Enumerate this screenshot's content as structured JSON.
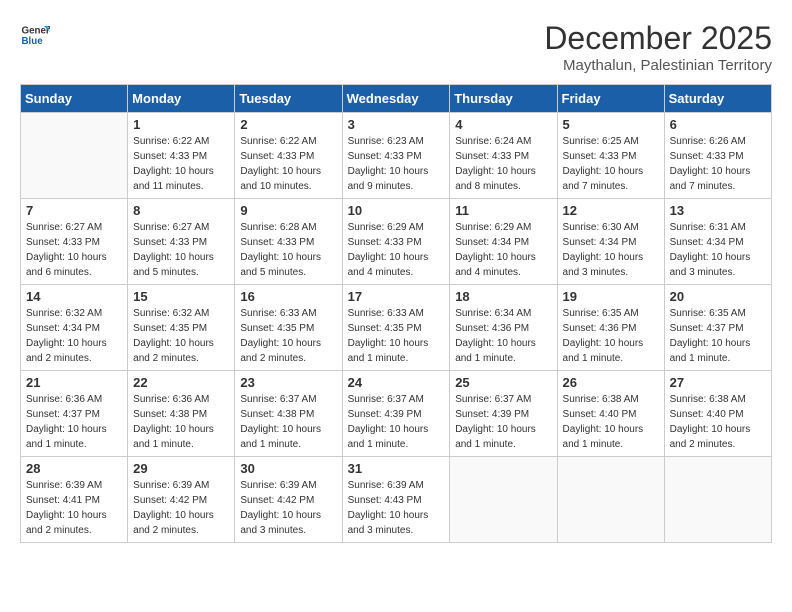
{
  "header": {
    "logo_line1": "General",
    "logo_line2": "Blue",
    "month_year": "December 2025",
    "location": "Maythalun, Palestinian Territory"
  },
  "weekdays": [
    "Sunday",
    "Monday",
    "Tuesday",
    "Wednesday",
    "Thursday",
    "Friday",
    "Saturday"
  ],
  "weeks": [
    [
      {
        "day": "",
        "info": ""
      },
      {
        "day": "1",
        "info": "Sunrise: 6:22 AM\nSunset: 4:33 PM\nDaylight: 10 hours\nand 11 minutes."
      },
      {
        "day": "2",
        "info": "Sunrise: 6:22 AM\nSunset: 4:33 PM\nDaylight: 10 hours\nand 10 minutes."
      },
      {
        "day": "3",
        "info": "Sunrise: 6:23 AM\nSunset: 4:33 PM\nDaylight: 10 hours\nand 9 minutes."
      },
      {
        "day": "4",
        "info": "Sunrise: 6:24 AM\nSunset: 4:33 PM\nDaylight: 10 hours\nand 8 minutes."
      },
      {
        "day": "5",
        "info": "Sunrise: 6:25 AM\nSunset: 4:33 PM\nDaylight: 10 hours\nand 7 minutes."
      },
      {
        "day": "6",
        "info": "Sunrise: 6:26 AM\nSunset: 4:33 PM\nDaylight: 10 hours\nand 7 minutes."
      }
    ],
    [
      {
        "day": "7",
        "info": "Sunrise: 6:27 AM\nSunset: 4:33 PM\nDaylight: 10 hours\nand 6 minutes."
      },
      {
        "day": "8",
        "info": "Sunrise: 6:27 AM\nSunset: 4:33 PM\nDaylight: 10 hours\nand 5 minutes."
      },
      {
        "day": "9",
        "info": "Sunrise: 6:28 AM\nSunset: 4:33 PM\nDaylight: 10 hours\nand 5 minutes."
      },
      {
        "day": "10",
        "info": "Sunrise: 6:29 AM\nSunset: 4:33 PM\nDaylight: 10 hours\nand 4 minutes."
      },
      {
        "day": "11",
        "info": "Sunrise: 6:29 AM\nSunset: 4:34 PM\nDaylight: 10 hours\nand 4 minutes."
      },
      {
        "day": "12",
        "info": "Sunrise: 6:30 AM\nSunset: 4:34 PM\nDaylight: 10 hours\nand 3 minutes."
      },
      {
        "day": "13",
        "info": "Sunrise: 6:31 AM\nSunset: 4:34 PM\nDaylight: 10 hours\nand 3 minutes."
      }
    ],
    [
      {
        "day": "14",
        "info": "Sunrise: 6:32 AM\nSunset: 4:34 PM\nDaylight: 10 hours\nand 2 minutes."
      },
      {
        "day": "15",
        "info": "Sunrise: 6:32 AM\nSunset: 4:35 PM\nDaylight: 10 hours\nand 2 minutes."
      },
      {
        "day": "16",
        "info": "Sunrise: 6:33 AM\nSunset: 4:35 PM\nDaylight: 10 hours\nand 2 minutes."
      },
      {
        "day": "17",
        "info": "Sunrise: 6:33 AM\nSunset: 4:35 PM\nDaylight: 10 hours\nand 1 minute."
      },
      {
        "day": "18",
        "info": "Sunrise: 6:34 AM\nSunset: 4:36 PM\nDaylight: 10 hours\nand 1 minute."
      },
      {
        "day": "19",
        "info": "Sunrise: 6:35 AM\nSunset: 4:36 PM\nDaylight: 10 hours\nand 1 minute."
      },
      {
        "day": "20",
        "info": "Sunrise: 6:35 AM\nSunset: 4:37 PM\nDaylight: 10 hours\nand 1 minute."
      }
    ],
    [
      {
        "day": "21",
        "info": "Sunrise: 6:36 AM\nSunset: 4:37 PM\nDaylight: 10 hours\nand 1 minute."
      },
      {
        "day": "22",
        "info": "Sunrise: 6:36 AM\nSunset: 4:38 PM\nDaylight: 10 hours\nand 1 minute."
      },
      {
        "day": "23",
        "info": "Sunrise: 6:37 AM\nSunset: 4:38 PM\nDaylight: 10 hours\nand 1 minute."
      },
      {
        "day": "24",
        "info": "Sunrise: 6:37 AM\nSunset: 4:39 PM\nDaylight: 10 hours\nand 1 minute."
      },
      {
        "day": "25",
        "info": "Sunrise: 6:37 AM\nSunset: 4:39 PM\nDaylight: 10 hours\nand 1 minute."
      },
      {
        "day": "26",
        "info": "Sunrise: 6:38 AM\nSunset: 4:40 PM\nDaylight: 10 hours\nand 1 minute."
      },
      {
        "day": "27",
        "info": "Sunrise: 6:38 AM\nSunset: 4:40 PM\nDaylight: 10 hours\nand 2 minutes."
      }
    ],
    [
      {
        "day": "28",
        "info": "Sunrise: 6:39 AM\nSunset: 4:41 PM\nDaylight: 10 hours\nand 2 minutes."
      },
      {
        "day": "29",
        "info": "Sunrise: 6:39 AM\nSunset: 4:42 PM\nDaylight: 10 hours\nand 2 minutes."
      },
      {
        "day": "30",
        "info": "Sunrise: 6:39 AM\nSunset: 4:42 PM\nDaylight: 10 hours\nand 3 minutes."
      },
      {
        "day": "31",
        "info": "Sunrise: 6:39 AM\nSunset: 4:43 PM\nDaylight: 10 hours\nand 3 minutes."
      },
      {
        "day": "",
        "info": ""
      },
      {
        "day": "",
        "info": ""
      },
      {
        "day": "",
        "info": ""
      }
    ]
  ]
}
